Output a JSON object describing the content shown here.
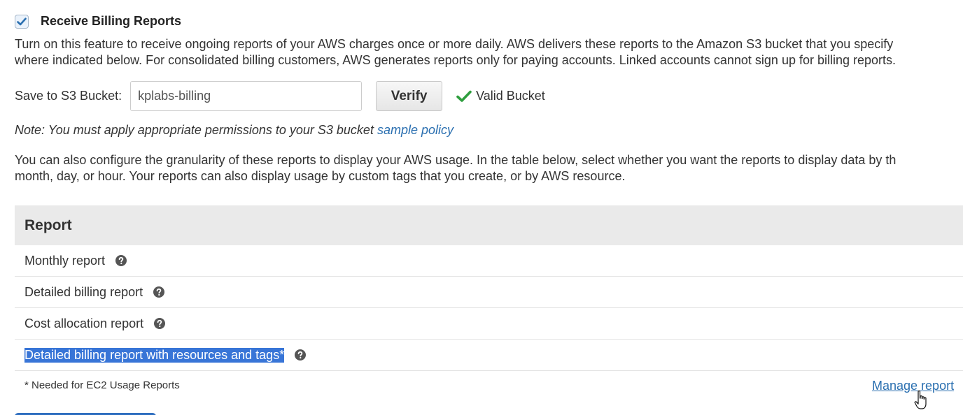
{
  "billing": {
    "checkbox_label": "Receive Billing Reports",
    "checked": true,
    "description_lines": [
      "Turn on this feature to receive ongoing reports of your AWS charges once or more daily. AWS delivers these reports to the Amazon S3 bucket that you specify",
      "where indicated below. For consolidated billing customers, AWS generates reports only for paying accounts. Linked accounts cannot sign up for billing reports."
    ]
  },
  "bucket": {
    "label": "Save to S3 Bucket:",
    "value": "kplabs-billing",
    "verify_label": "Verify",
    "status_text": "Valid Bucket",
    "status_color": "#2e9e3e"
  },
  "note": {
    "text": "Note: You must apply appropriate permissions to your S3 bucket",
    "link": "sample policy"
  },
  "granularity": {
    "lines": [
      "You can also configure the granularity of these reports to display your AWS usage. In the table below, select whether you want the reports to display data by th",
      "month, day, or hour. Your reports can also display usage by custom tags that you create, or by AWS resource."
    ]
  },
  "table": {
    "header": "Report",
    "rows": [
      {
        "label": "Monthly report",
        "icon": "help-icon"
      },
      {
        "label": "Detailed billing report",
        "icon": "help-icon"
      },
      {
        "label": "Cost allocation report",
        "icon": "help-icon"
      },
      {
        "label": "Detailed billing report with resources and tags*",
        "icon": "help-icon",
        "selected": true
      }
    ]
  },
  "footer": {
    "note": "* Needed for EC2 Usage Reports",
    "manage_link": "Manage report"
  },
  "colors": {
    "link": "#2a6fb0",
    "selection": "#3875d7",
    "header_bg": "#eaeaea"
  }
}
